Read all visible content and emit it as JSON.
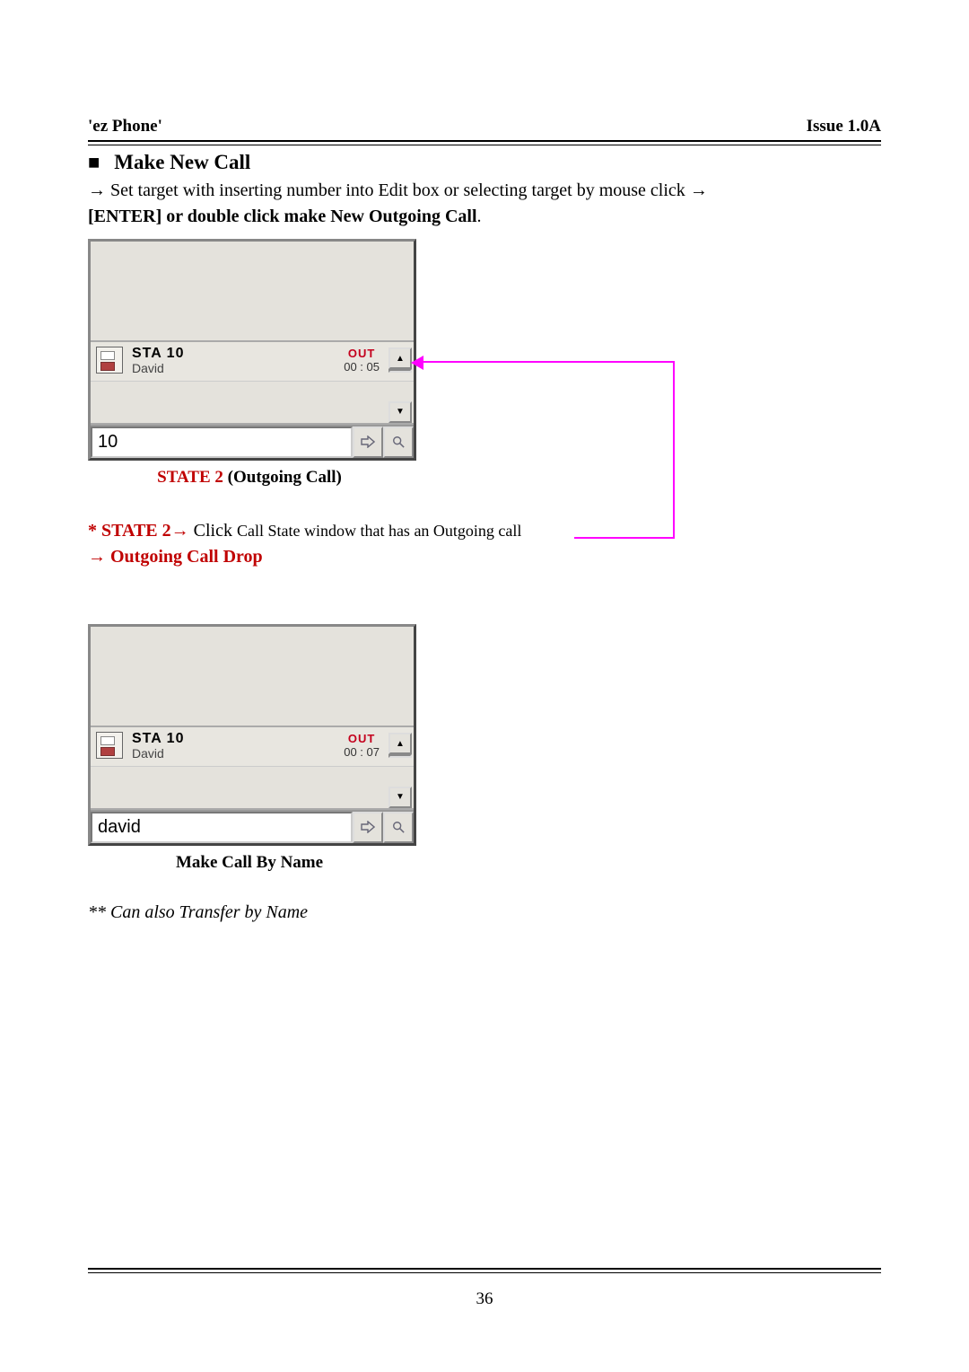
{
  "header": {
    "left": "'ez Phone'",
    "right": "Issue 1.0A"
  },
  "section": {
    "bullet": "■",
    "title": "Make New Call",
    "line1_prefix_arrow": "→",
    "line1_text": " Set target with inserting number into Edit box or selecting target by mouse click ",
    "line1_suffix_arrow": "→",
    "line2_bold": "[ENTER] or double click make New Outgoing Call",
    "line2_period": "."
  },
  "panel1": {
    "station": "STA 10",
    "name": "David",
    "out_label": "OUT",
    "time": "00 : 05",
    "input_value": "10",
    "scroll_up": "▲",
    "scroll_down": "▼",
    "go_icon": "⇨",
    "search_icon": "🔍"
  },
  "caption1": {
    "state": "STATE 2",
    "rest": " (Outgoing Call)"
  },
  "state2_line": {
    "star_state": "* STATE 2",
    "arrow": "→",
    "click": " Click ",
    "rest": "Call State window that has an Outgoing call"
  },
  "drop_line": {
    "arrow": "→",
    "text": " Outgoing Call Drop"
  },
  "panel2": {
    "station": "STA 10",
    "name": "David",
    "out_label": "OUT",
    "time": "00 : 07",
    "input_value": "david",
    "scroll_up": "▲",
    "scroll_down": "▼",
    "go_icon": "⇨",
    "search_icon": "🔍"
  },
  "caption2": "Make Call By Name",
  "transfer_note": "** Can also Transfer by Name",
  "page_number": "36"
}
